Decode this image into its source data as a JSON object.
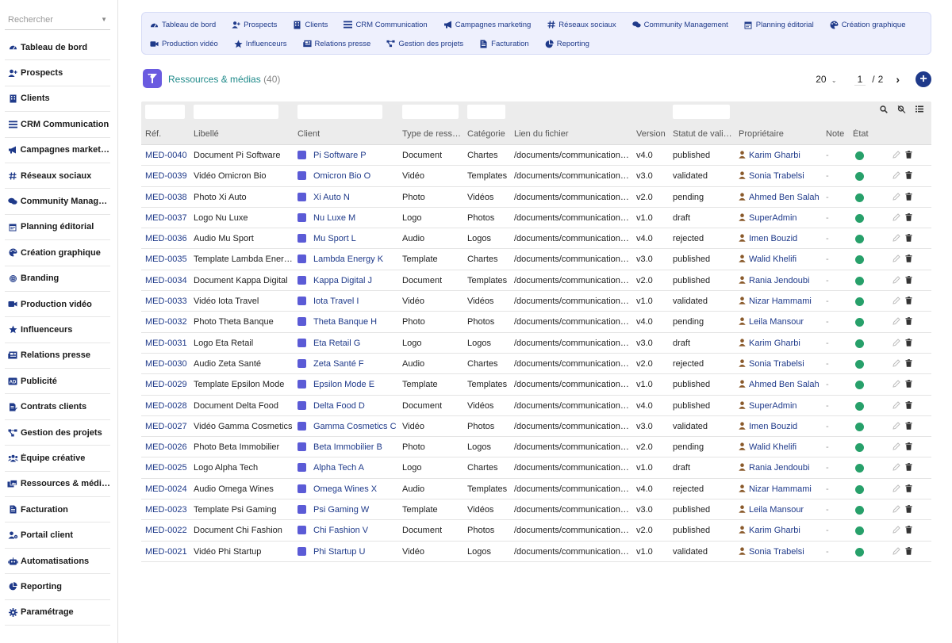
{
  "sidebar": {
    "search_placeholder": "Rechercher",
    "items": [
      {
        "label": "Tableau de bord",
        "icon": "dashboard-icon"
      },
      {
        "label": "Prospects",
        "icon": "user-plus-icon"
      },
      {
        "label": "Clients",
        "icon": "building-icon"
      },
      {
        "label": "CRM Communication",
        "icon": "list-icon"
      },
      {
        "label": "Campagnes marketing",
        "icon": "megaphone-icon"
      },
      {
        "label": "Réseaux sociaux",
        "icon": "hashtag-icon"
      },
      {
        "label": "Community Manage…",
        "icon": "comments-icon"
      },
      {
        "label": "Planning éditorial",
        "icon": "calendar-icon"
      },
      {
        "label": "Création graphique",
        "icon": "palette-icon"
      },
      {
        "label": "Branding",
        "icon": "fingerprint-icon"
      },
      {
        "label": "Production vidéo",
        "icon": "video-icon"
      },
      {
        "label": "Influenceurs",
        "icon": "star-icon"
      },
      {
        "label": "Relations presse",
        "icon": "newspaper-icon"
      },
      {
        "label": "Publicité",
        "icon": "ad-icon"
      },
      {
        "label": "Contrats clients",
        "icon": "contract-icon"
      },
      {
        "label": "Gestion des projets",
        "icon": "project-diagram-icon"
      },
      {
        "label": "Équipe créative",
        "icon": "users-icon"
      },
      {
        "label": "Ressources & médias",
        "icon": "photo-video-icon"
      },
      {
        "label": "Facturation",
        "icon": "invoice-icon"
      },
      {
        "label": "Portail client",
        "icon": "user-cog-icon"
      },
      {
        "label": "Automatisations",
        "icon": "robot-icon"
      },
      {
        "label": "Reporting",
        "icon": "pie-chart-icon"
      },
      {
        "label": "Paramétrage",
        "icon": "gear-icon"
      }
    ]
  },
  "topnav": {
    "row1": [
      {
        "label": "Tableau de bord",
        "icon": "dashboard-icon"
      },
      {
        "label": "Prospects",
        "icon": "user-plus-icon"
      },
      {
        "label": "Clients",
        "icon": "building-icon"
      },
      {
        "label": "CRM Communication",
        "icon": "list-icon"
      },
      {
        "label": "Campagnes marketing",
        "icon": "megaphone-icon"
      },
      {
        "label": "Réseaux sociaux",
        "icon": "hashtag-icon"
      },
      {
        "label": "Community Management",
        "icon": "comments-icon"
      },
      {
        "label": "Planning éditorial",
        "icon": "calendar-icon"
      },
      {
        "label": "Création graphique",
        "icon": "palette-icon"
      }
    ],
    "row2": [
      {
        "label": "Production vidéo",
        "icon": "video-icon"
      },
      {
        "label": "Influenceurs",
        "icon": "star-icon"
      },
      {
        "label": "Relations presse",
        "icon": "newspaper-icon"
      },
      {
        "label": "Gestion des projets",
        "icon": "project-diagram-icon"
      },
      {
        "label": "Facturation",
        "icon": "invoice-icon"
      },
      {
        "label": "Reporting",
        "icon": "pie-chart-icon"
      }
    ]
  },
  "header": {
    "title": "Ressources & médias",
    "count": "(40)",
    "page_size": "20",
    "page": "1",
    "page_sep": "/",
    "total_pages": "2",
    "next": "›",
    "add": "+"
  },
  "columns": [
    "Réf.",
    "Libellé",
    "Client",
    "Type de ress…",
    "Catégorie",
    "Lien du fichier",
    "Version",
    "Statut de vali…",
    "Propriétaire",
    "Note",
    "État"
  ],
  "rows": [
    {
      "ref": "MED-0040",
      "label": "Document Pi Software",
      "client": "Pi Software P",
      "type": "Document",
      "cat": "Chartes",
      "link": "/documents/communication…",
      "version": "v4.0",
      "status": "published",
      "owner": "Karim Gharbi",
      "note": "-"
    },
    {
      "ref": "MED-0039",
      "label": "Vidéo Omicron Bio",
      "client": "Omicron Bio O",
      "type": "Vidéo",
      "cat": "Templates",
      "link": "/documents/communication…",
      "version": "v3.0",
      "status": "validated",
      "owner": "Sonia Trabelsi",
      "note": "-"
    },
    {
      "ref": "MED-0038",
      "label": "Photo Xi Auto",
      "client": "Xi Auto N",
      "type": "Photo",
      "cat": "Vidéos",
      "link": "/documents/communication…",
      "version": "v2.0",
      "status": "pending",
      "owner": "Ahmed Ben Salah",
      "note": "-"
    },
    {
      "ref": "MED-0037",
      "label": "Logo Nu Luxe",
      "client": "Nu Luxe M",
      "type": "Logo",
      "cat": "Photos",
      "link": "/documents/communication…",
      "version": "v1.0",
      "status": "draft",
      "owner": "SuperAdmin",
      "note": "-"
    },
    {
      "ref": "MED-0036",
      "label": "Audio Mu Sport",
      "client": "Mu Sport L",
      "type": "Audio",
      "cat": "Logos",
      "link": "/documents/communication…",
      "version": "v4.0",
      "status": "rejected",
      "owner": "Imen Bouzid",
      "note": "-"
    },
    {
      "ref": "MED-0035",
      "label": "Template Lambda Energy",
      "client": "Lambda Energy K",
      "type": "Template",
      "cat": "Chartes",
      "link": "/documents/communication…",
      "version": "v3.0",
      "status": "published",
      "owner": "Walid Khelifi",
      "note": "-"
    },
    {
      "ref": "MED-0034",
      "label": "Document Kappa Digital",
      "client": "Kappa Digital J",
      "type": "Document",
      "cat": "Templates",
      "link": "/documents/communication…",
      "version": "v2.0",
      "status": "published",
      "owner": "Rania Jendoubi",
      "note": "-"
    },
    {
      "ref": "MED-0033",
      "label": "Vidéo Iota Travel",
      "client": "Iota Travel I",
      "type": "Vidéo",
      "cat": "Vidéos",
      "link": "/documents/communication…",
      "version": "v1.0",
      "status": "validated",
      "owner": "Nizar Hammami",
      "note": "-"
    },
    {
      "ref": "MED-0032",
      "label": "Photo Theta Banque",
      "client": "Theta Banque H",
      "type": "Photo",
      "cat": "Photos",
      "link": "/documents/communication…",
      "version": "v4.0",
      "status": "pending",
      "owner": "Leila Mansour",
      "note": "-"
    },
    {
      "ref": "MED-0031",
      "label": "Logo Eta Retail",
      "client": "Eta Retail G",
      "type": "Logo",
      "cat": "Logos",
      "link": "/documents/communication…",
      "version": "v3.0",
      "status": "draft",
      "owner": "Karim Gharbi",
      "note": "-"
    },
    {
      "ref": "MED-0030",
      "label": "Audio Zeta Santé",
      "client": "Zeta Santé F",
      "type": "Audio",
      "cat": "Chartes",
      "link": "/documents/communication…",
      "version": "v2.0",
      "status": "rejected",
      "owner": "Sonia Trabelsi",
      "note": "-"
    },
    {
      "ref": "MED-0029",
      "label": "Template Epsilon Mode",
      "client": "Epsilon Mode E",
      "type": "Template",
      "cat": "Templates",
      "link": "/documents/communication…",
      "version": "v1.0",
      "status": "published",
      "owner": "Ahmed Ben Salah",
      "note": "-"
    },
    {
      "ref": "MED-0028",
      "label": "Document Delta Food",
      "client": "Delta Food D",
      "type": "Document",
      "cat": "Vidéos",
      "link": "/documents/communication…",
      "version": "v4.0",
      "status": "published",
      "owner": "SuperAdmin",
      "note": "-"
    },
    {
      "ref": "MED-0027",
      "label": "Vidéo Gamma Cosmetics",
      "client": "Gamma Cosmetics C",
      "type": "Vidéo",
      "cat": "Photos",
      "link": "/documents/communication…",
      "version": "v3.0",
      "status": "validated",
      "owner": "Imen Bouzid",
      "note": "-"
    },
    {
      "ref": "MED-0026",
      "label": "Photo Beta Immobilier",
      "client": "Beta Immobilier B",
      "type": "Photo",
      "cat": "Logos",
      "link": "/documents/communication…",
      "version": "v2.0",
      "status": "pending",
      "owner": "Walid Khelifi",
      "note": "-"
    },
    {
      "ref": "MED-0025",
      "label": "Logo Alpha Tech",
      "client": "Alpha Tech A",
      "type": "Logo",
      "cat": "Chartes",
      "link": "/documents/communication…",
      "version": "v1.0",
      "status": "draft",
      "owner": "Rania Jendoubi",
      "note": "-"
    },
    {
      "ref": "MED-0024",
      "label": "Audio Omega Wines",
      "client": "Omega Wines X",
      "type": "Audio",
      "cat": "Templates",
      "link": "/documents/communication…",
      "version": "v4.0",
      "status": "rejected",
      "owner": "Nizar Hammami",
      "note": "-"
    },
    {
      "ref": "MED-0023",
      "label": "Template Psi Gaming",
      "client": "Psi Gaming W",
      "type": "Template",
      "cat": "Vidéos",
      "link": "/documents/communication…",
      "version": "v3.0",
      "status": "published",
      "owner": "Leila Mansour",
      "note": "-"
    },
    {
      "ref": "MED-0022",
      "label": "Document Chi Fashion",
      "client": "Chi Fashion V",
      "type": "Document",
      "cat": "Photos",
      "link": "/documents/communication…",
      "version": "v2.0",
      "status": "published",
      "owner": "Karim Gharbi",
      "note": "-"
    },
    {
      "ref": "MED-0021",
      "label": "Vidéo Phi Startup",
      "client": "Phi Startup U",
      "type": "Vidéo",
      "cat": "Logos",
      "link": "/documents/communication…",
      "version": "v1.0",
      "status": "validated",
      "owner": "Sonia Trabelsi",
      "note": "-"
    }
  ],
  "colors": {
    "accent": "#1f3a8a",
    "title": "#1f8a8a",
    "state_ok": "#27a06a",
    "nav_bg": "#eef0fd",
    "logo": "#6a5be0",
    "owner_icon": "#8a5a2b"
  }
}
